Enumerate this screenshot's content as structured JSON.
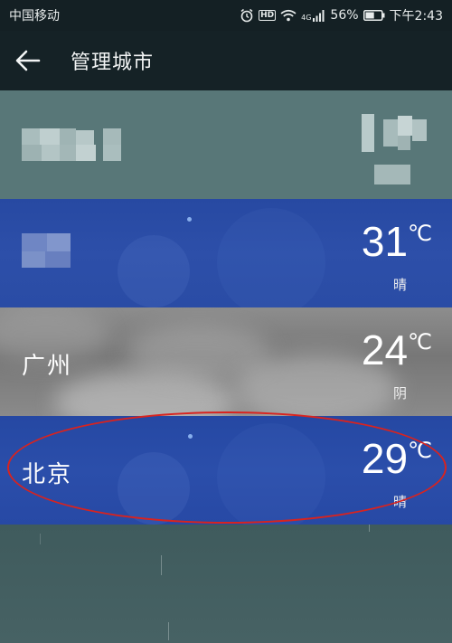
{
  "status_bar": {
    "carrier": "中国移动",
    "network_tag": "4G",
    "hd_tag": "HD",
    "battery_percent": "56%",
    "time": "下午2:43",
    "battery_level": 0.56
  },
  "app_bar": {
    "title": "管理城市",
    "back_icon": "arrow-left-icon"
  },
  "cities": [
    {
      "name": "",
      "temp": "",
      "unit": "",
      "condition": "",
      "background": "current-location",
      "obscured": true
    },
    {
      "name": "",
      "temp": "31",
      "unit": "℃",
      "condition": "晴",
      "background": "sunny",
      "obscured_name": true
    },
    {
      "name": "广州",
      "temp": "24",
      "unit": "℃",
      "condition": "阴",
      "background": "cloudy"
    },
    {
      "name": "北京",
      "temp": "29",
      "unit": "℃",
      "condition": "晴",
      "background": "sunny",
      "highlighted": true
    }
  ],
  "colors": {
    "highlight": "#d8231f",
    "sunny_bg": "#2a4ca5",
    "cloudy_bg": "#808080",
    "current_bg": "#587778",
    "app_bar_bg": "#152226"
  }
}
